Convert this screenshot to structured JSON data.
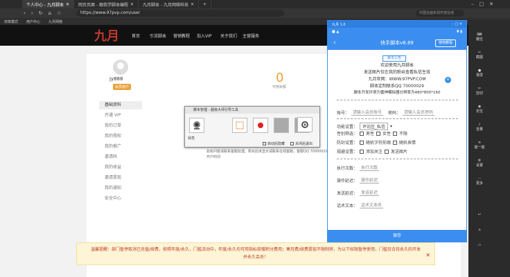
{
  "browser": {
    "tabs": [
      {
        "label": "个人中心 - 九月脚本"
      },
      {
        "label": "网页页面 - 跟我学脚本编程"
      },
      {
        "label": "九月脚本 - 九月网络科技"
      }
    ],
    "url": "https://www.97pvp.com/user",
    "search_placeholder": "中国全面实现开放在线",
    "bookmarks": [
      "双核模式",
      "用户中心",
      "九月网络"
    ]
  },
  "site": {
    "logo": "九月",
    "nav": [
      "首页",
      "引流脚本",
      "营销教程",
      "加入VIP",
      "关于我们",
      "主营服务"
    ],
    "user": {
      "name": "jy888",
      "badge": "会员用户"
    },
    "sidebar": [
      "基础资料",
      "开通 VIP",
      "我的订单",
      "我的授权",
      "我的推广",
      "邀请码",
      "我的收益",
      "邀请提现",
      "我的通知",
      "安全中心"
    ],
    "stat_value": "0",
    "stat_label": "可用余额",
    "info": "如有问题请联系客服处理，购买后未显示请联系在线客服，客服QQ 70000029 开户时间"
  },
  "notice": {
    "text": "温馨提醒：部门暂停取消已充值/续费，依照年度/永久，门槛活动中，年度/永久均可用指标获赠积分费用；寒月费/续费提现不限制将，为以下权限暂停使用，门槛仅合持永久的开发并永久会员！",
    "close": "✕"
  },
  "tool_popup": {
    "title": "脚本管理 - 超级大师引导工具",
    "status": "状态",
    "checkbox1": "启动后隐藏",
    "checkbox2": "关闭后退出"
  },
  "phone": {
    "app_title": "九月 1.0",
    "header_title": "快手脚本v8.89",
    "tutorial": "使用教程",
    "announce_title": "脚本公告",
    "announce_lines": [
      "欢迎使用九月脚本",
      "发送图片仅在我的粉丝查看私信生效",
      "九月官网：WWW.97PVP.COM",
      "脚本定制联系QQ 70000029",
      "脚本开发环境为雷神模拟器分辨率为480*800*160"
    ],
    "account_label": "账号：",
    "account_placeholder": "请输入会员账号",
    "password_label": "密码：",
    "password_placeholder": "请输入会员密码",
    "function_label": "功能设置：",
    "function_value": "评论区_私信",
    "gender_label": "性别筛选：",
    "gender_opts": [
      "男性",
      "女性",
      "不限"
    ],
    "protect_label": "防封设置：",
    "protect_opts": [
      "随机字符前缀",
      "随机表情"
    ],
    "extra_label": "规避设置：",
    "extra_opts": [
      "添加关注",
      "发送图片"
    ],
    "exec_label": "执行次数：",
    "exec_placeholder": "执行次数",
    "op_label": "操作延迟：",
    "op_placeholder": "操作延迟",
    "send_label": "发送延迟：",
    "send_placeholder": "发送延迟",
    "text_label": "话术文本：",
    "text_placeholder": "话术文本名",
    "save": "保存"
  },
  "rail": [
    "键位",
    "截图",
    "录屏",
    "剪切",
    "定位",
    "音量",
    "摇一摇",
    "设置",
    "更多"
  ]
}
